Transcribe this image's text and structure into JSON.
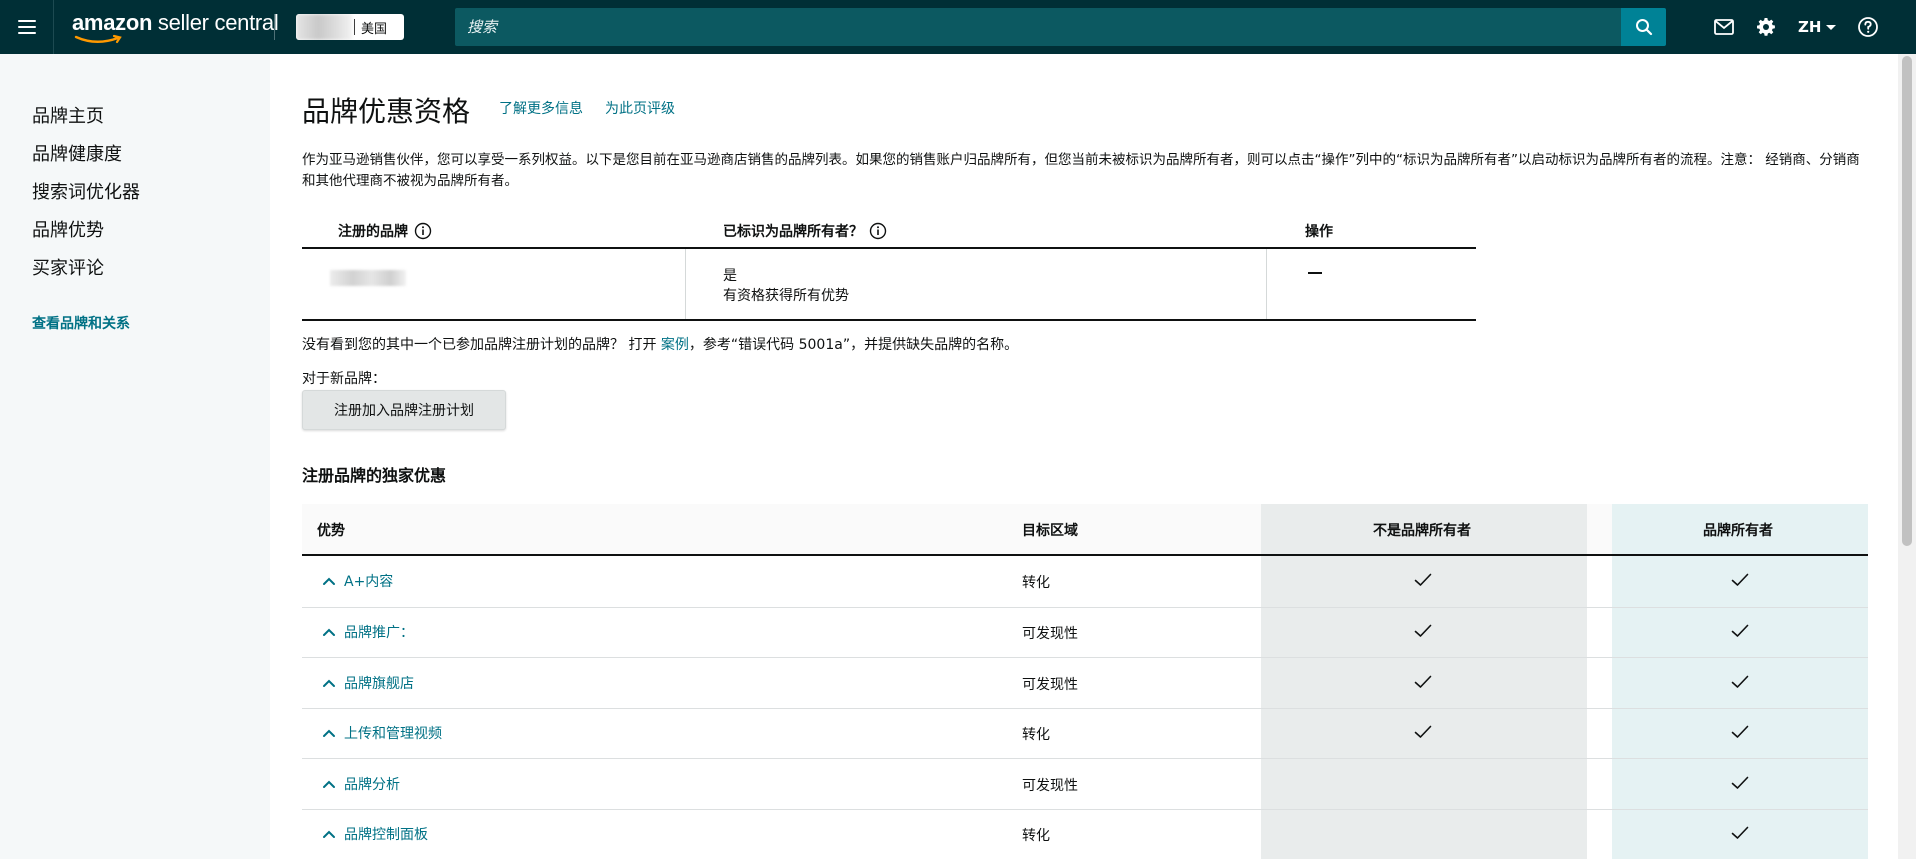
{
  "topbar": {
    "logo_bold": "amazon",
    "logo_rest": " seller central",
    "marketplace": "美国",
    "search_placeholder": "搜索",
    "language": "ZH"
  },
  "sidebar": {
    "items": [
      "品牌主页",
      "品牌健康度",
      "搜索词优化器",
      "品牌优势",
      "买家评论"
    ],
    "link": "查看品牌和关系"
  },
  "page": {
    "title": "品牌优惠资格",
    "learn_more": "了解更多信息",
    "rate_page": "为此页评级",
    "intro": "作为亚马逊销售伙伴，您可以享受一系列权益。以下是您目前在亚马逊商店销售的品牌列表。如果您的销售账户归品牌所有，但您当前未被标识为品牌所有者，则可以点击“操作”列中的“标识为品牌所有者”以启动标识为品牌所有者的流程。注意： 经销商、分销商和其他代理商不被视为品牌所有者。"
  },
  "brand_table": {
    "headers": {
      "brand": "注册的品牌",
      "identified": "已标识为品牌所有者？",
      "action": "操作"
    },
    "row": {
      "identified_value": "是",
      "identified_note": "有资格获得所有优势"
    }
  },
  "missing_note": {
    "before": "没有看到您的其中一个已参加品牌注册计划的品牌？ 打开 ",
    "link": "案例",
    "after": "，参考“错误代码 5001a”，并提供缺失品牌的名称。"
  },
  "new_brand": {
    "label": "对于新品牌：",
    "button": "注册加入品牌注册计划"
  },
  "benefits": {
    "title": "注册品牌的独家优惠",
    "headers": {
      "benefit": "优势",
      "zone": "目标区域",
      "non_owner": "不是品牌所有者",
      "owner": "品牌所有者"
    },
    "rows": [
      {
        "label": "A+内容",
        "zone": "转化",
        "non_owner": true,
        "owner": true
      },
      {
        "label": "品牌推广：",
        "zone": "可发现性",
        "non_owner": true,
        "owner": true
      },
      {
        "label": "品牌旗舰店",
        "zone": "可发现性",
        "non_owner": true,
        "owner": true
      },
      {
        "label": "上传和管理视频",
        "zone": "转化",
        "non_owner": true,
        "owner": true
      },
      {
        "label": "品牌分析",
        "zone": "可发现性",
        "non_owner": false,
        "owner": true
      },
      {
        "label": "品牌控制面板",
        "zone": "转化",
        "non_owner": false,
        "owner": true
      }
    ]
  }
}
